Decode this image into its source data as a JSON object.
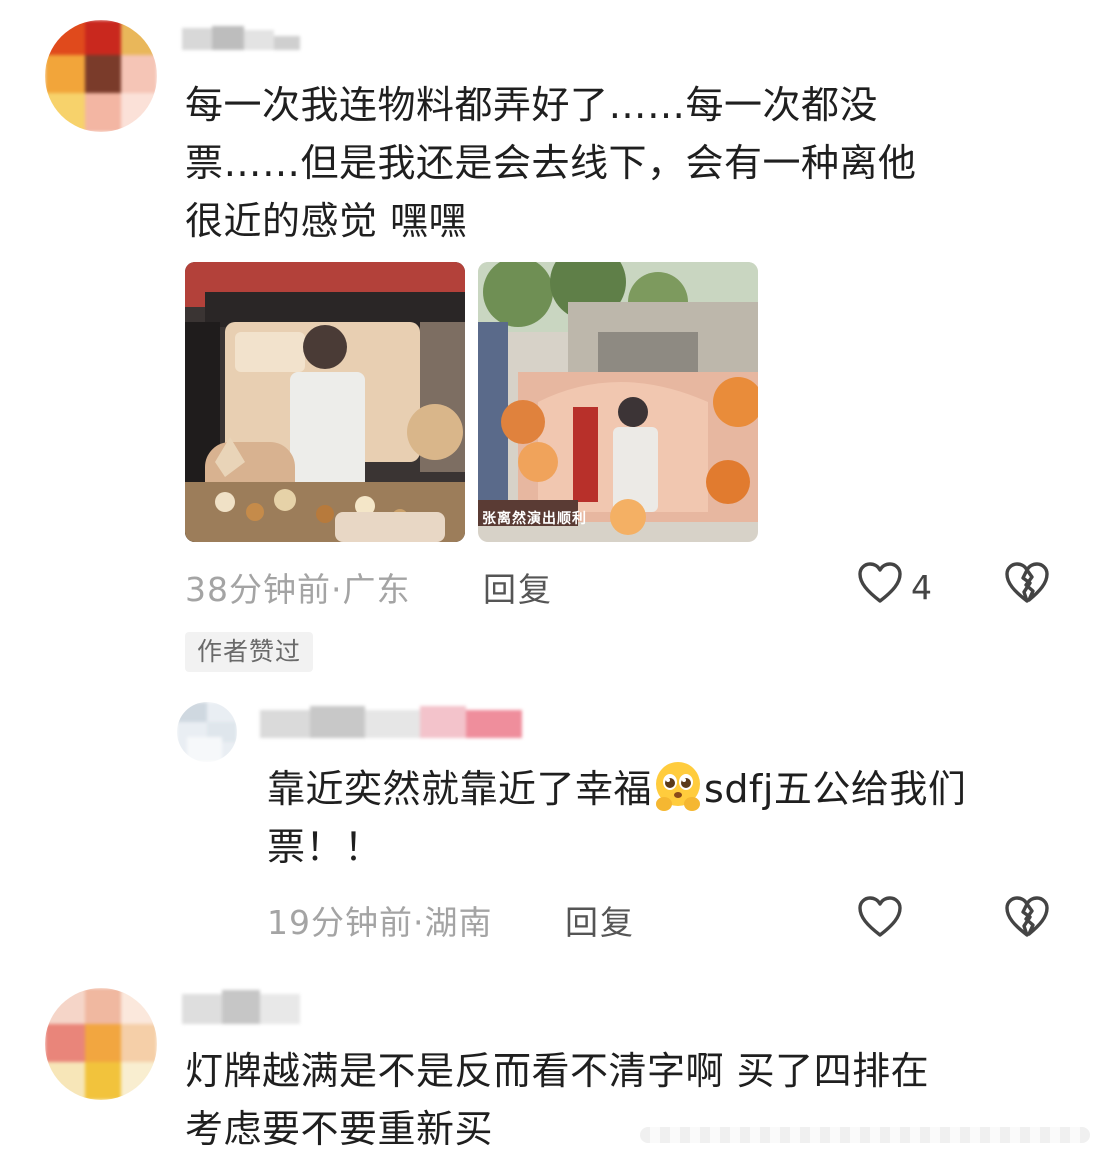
{
  "comments": [
    {
      "text_lines": [
        "每一次我连物料都弄好了……每一次都没",
        "票……但是我还是会去线下，会有一种离他",
        "很近的感觉 嘿嘿"
      ],
      "photos": [
        {
          "caption": "",
          "icon": "photo-booth-display"
        },
        {
          "caption": "张离然演出顺利",
          "icon": "photo-flower-stand"
        }
      ],
      "time_location": "38分钟前·广东",
      "reply_label": "回复",
      "like_count": "4",
      "badge": "作者赞过"
    },
    {
      "text_line1_pre": "靠近奕然就靠近了幸福",
      "text_line1_post": "sdfj五公给我们",
      "text_line2": "票！！",
      "emoji": "pleading-face-emoji",
      "time_location": "19分钟前·湖南",
      "reply_label": "回复",
      "like_count": ""
    },
    {
      "text_lines": [
        "灯牌越满是不是反而看不清字啊 买了四排在",
        "考虑要不要重新买"
      ]
    }
  ],
  "colors": {
    "text": "#1f1f1f",
    "meta": "#a4a4a4",
    "badge_bg": "#f2f2f2",
    "icon": "#444444"
  }
}
